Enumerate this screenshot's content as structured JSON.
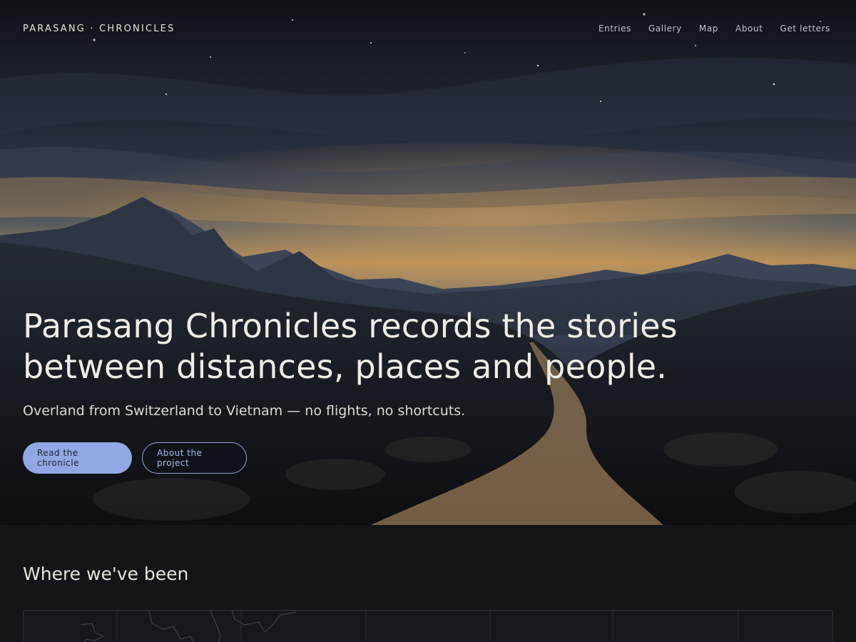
{
  "site": {
    "brand": "PARASANG · CHRONICLES",
    "nav": [
      {
        "label": "Entries"
      },
      {
        "label": "Gallery"
      },
      {
        "label": "Map"
      },
      {
        "label": "About"
      },
      {
        "label": "Get letters"
      }
    ]
  },
  "hero": {
    "title": "Parasang Chronicles records the stories between distances, places and people.",
    "subtitle": "Overland from Switzerland to Vietnam — no flights, no shortcuts.",
    "primary_cta": "Read the chronicle",
    "secondary_cta": "About the project",
    "background_icon": "mountain-road-night-illustration"
  },
  "map_section": {
    "title": "Where we've been"
  },
  "colors": {
    "accent": "#92a8e4",
    "accent_outline": "#8fa3d8",
    "page_bg": "#141519",
    "sky_dark": "#1b1f2b",
    "sunset": "#c99a5a"
  }
}
